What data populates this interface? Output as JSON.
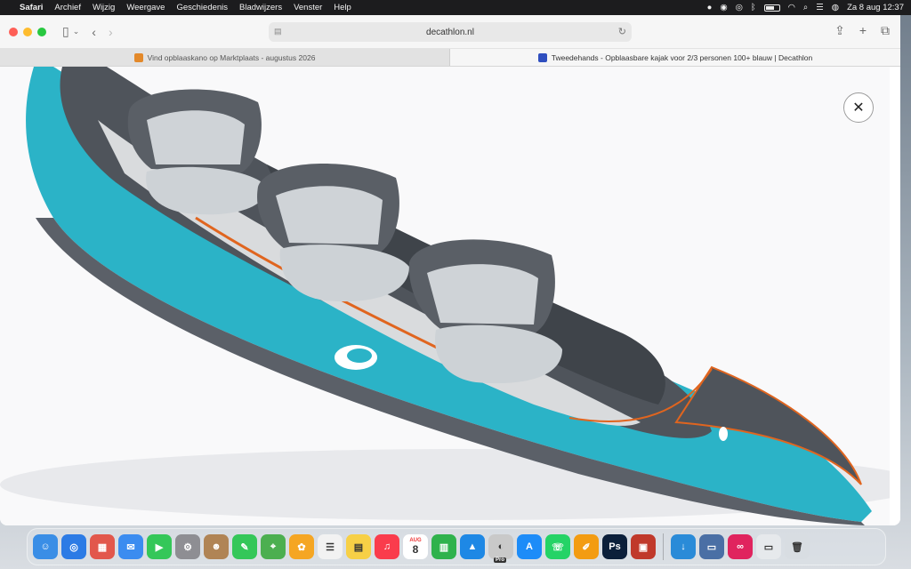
{
  "menubar": {
    "app": "Safari",
    "items": [
      "Archief",
      "Wijzig",
      "Weergave",
      "Geschiedenis",
      "Bladwijzers",
      "Venster",
      "Help"
    ],
    "clock": "Za 8 aug  12:37"
  },
  "toolbar": {
    "address": "decathlon.nl"
  },
  "tabs": [
    {
      "title": "Vind opblaaskano op Marktplaats - augustus 2026",
      "favicon": "marktplaats-icon",
      "active": false
    },
    {
      "title": "Tweedehands - Opblaasbare kajak voor 2/3 personen 100+ blauw | Decathlon",
      "favicon": "decathlon-icon",
      "active": true
    }
  ],
  "content": {
    "image_subject": "inflatable-kayak-image",
    "close_symbol": "✕",
    "colors": {
      "kayak_teal": "#2bb3c7",
      "kayak_grey": "#5b6068",
      "seat_light": "#cdd2d6",
      "accent_orange": "#e0651f"
    }
  },
  "dock": {
    "apps": [
      {
        "name": "finder-icon",
        "color": "#3a8ee6",
        "glyph": "☺"
      },
      {
        "name": "safari-icon",
        "color": "#2c7be5",
        "glyph": "◎"
      },
      {
        "name": "launchpad-icon",
        "color": "#e2574c",
        "glyph": "▦"
      },
      {
        "name": "mail-icon",
        "color": "#3b8cf0",
        "glyph": "✉"
      },
      {
        "name": "facetime-icon",
        "color": "#35c759",
        "glyph": "▶"
      },
      {
        "name": "settings-icon",
        "color": "#8e8e93",
        "glyph": "⚙"
      },
      {
        "name": "contacts-icon",
        "color": "#b08455",
        "glyph": "☻"
      },
      {
        "name": "messages-icon",
        "color": "#34c759",
        "glyph": "✎"
      },
      {
        "name": "maps-icon",
        "color": "#4caf50",
        "glyph": "⌖"
      },
      {
        "name": "photos-icon",
        "color": "#f5a623",
        "glyph": "✿"
      },
      {
        "name": "reminders-icon",
        "color": "#f2f2f2",
        "glyph": "☰"
      },
      {
        "name": "notes-icon",
        "color": "#f7d046",
        "glyph": "▤"
      },
      {
        "name": "music-icon",
        "color": "#fa3c4c",
        "glyph": "♫"
      },
      {
        "name": "calendar-icon",
        "color": "#ffffff",
        "glyph": "8"
      },
      {
        "name": "numbers-icon",
        "color": "#2fb24c",
        "glyph": "▥"
      },
      {
        "name": "keynote-icon",
        "color": "#1e88e5",
        "glyph": "▲"
      },
      {
        "name": "pro-app-icon",
        "color": "#c9c9c9",
        "glyph": "◐"
      },
      {
        "name": "app-store-icon",
        "color": "#1d8cf8",
        "glyph": "A"
      },
      {
        "name": "whatsapp-icon",
        "color": "#25d366",
        "glyph": "☏"
      },
      {
        "name": "pages-icon",
        "color": "#f39c12",
        "glyph": "✐"
      },
      {
        "name": "photoshop-icon",
        "color": "#0b1f3a",
        "glyph": "Ps"
      },
      {
        "name": "dictionary-icon",
        "color": "#c0392b",
        "glyph": "▣"
      }
    ],
    "extras": [
      {
        "name": "downloads-icon",
        "color": "#2a8bd8",
        "glyph": "↓"
      },
      {
        "name": "preview-icon",
        "color": "#4a6fa5",
        "glyph": "▭"
      },
      {
        "name": "creative-cloud-icon",
        "color": "#e0245e",
        "glyph": "∞"
      },
      {
        "name": "window-thumbnail-icon",
        "color": "#e6e9ec",
        "glyph": "▭"
      },
      {
        "name": "trash-icon",
        "color": "#d8dde2",
        "glyph": "🗑"
      }
    ],
    "calendar_month": "AUG",
    "pro_label": "Pro"
  }
}
